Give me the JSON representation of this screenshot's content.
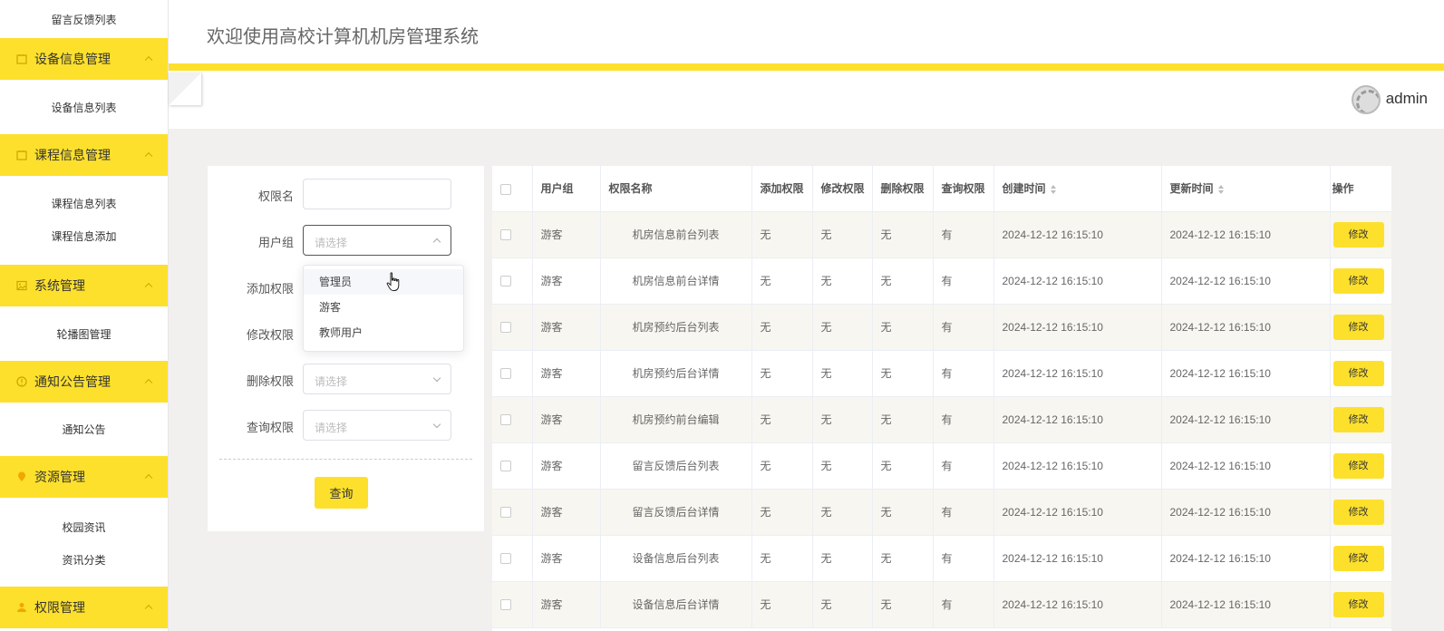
{
  "header": {
    "title": "欢迎使用高校计算机机房管理系统",
    "username": "admin"
  },
  "sidebar": {
    "top_sub": "留言反馈列表",
    "groups": [
      {
        "label": "设备信息管理",
        "icon": "calendar-icon",
        "items": [
          "设备信息列表"
        ]
      },
      {
        "label": "课程信息管理",
        "icon": "calendar-icon",
        "items": [
          "课程信息列表",
          "课程信息添加"
        ]
      },
      {
        "label": "系统管理",
        "icon": "image-icon",
        "items": [
          "轮播图管理"
        ]
      },
      {
        "label": "通知公告管理",
        "icon": "info-icon",
        "items": [
          "通知公告"
        ]
      },
      {
        "label": "资源管理",
        "icon": "location-icon",
        "items": [
          "校园资讯",
          "资讯分类"
        ]
      },
      {
        "label": "权限管理",
        "icon": "user-icon",
        "items": []
      }
    ]
  },
  "search": {
    "perm_name_label": "权限名",
    "user_group_label": "用户组",
    "user_group_placeholder": "请选择",
    "add_label": "添加权限",
    "modify_label": "修改权限",
    "delete_label": "删除权限",
    "delete_placeholder": "请选择",
    "query_label": "查询权限",
    "query_placeholder": "请选择",
    "dropdown_options": [
      "管理员",
      "游客",
      "教师用户"
    ],
    "query_button": "查询"
  },
  "table": {
    "columns": [
      "用户组",
      "权限名称",
      "添加权限",
      "修改权限",
      "删除权限",
      "查询权限",
      "创建时间",
      "更新时间",
      "操作"
    ],
    "edit_label": "修改",
    "rows": [
      [
        "游客",
        "机房信息前台列表",
        "无",
        "无",
        "无",
        "有",
        "2024-12-12 16:15:10",
        "2024-12-12 16:15:10"
      ],
      [
        "游客",
        "机房信息前台详情",
        "无",
        "无",
        "无",
        "有",
        "2024-12-12 16:15:10",
        "2024-12-12 16:15:10"
      ],
      [
        "游客",
        "机房预约后台列表",
        "无",
        "无",
        "无",
        "有",
        "2024-12-12 16:15:10",
        "2024-12-12 16:15:10"
      ],
      [
        "游客",
        "机房预约后台详情",
        "无",
        "无",
        "无",
        "有",
        "2024-12-12 16:15:10",
        "2024-12-12 16:15:10"
      ],
      [
        "游客",
        "机房预约前台编辑",
        "无",
        "无",
        "无",
        "有",
        "2024-12-12 16:15:10",
        "2024-12-12 16:15:10"
      ],
      [
        "游客",
        "留言反馈后台列表",
        "无",
        "无",
        "无",
        "有",
        "2024-12-12 16:15:10",
        "2024-12-12 16:15:10"
      ],
      [
        "游客",
        "留言反馈后台详情",
        "无",
        "无",
        "无",
        "有",
        "2024-12-12 16:15:10",
        "2024-12-12 16:15:10"
      ],
      [
        "游客",
        "设备信息后台列表",
        "无",
        "无",
        "无",
        "有",
        "2024-12-12 16:15:10",
        "2024-12-12 16:15:10"
      ],
      [
        "游客",
        "设备信息后台详情",
        "无",
        "无",
        "无",
        "有",
        "2024-12-12 16:15:10",
        "2024-12-12 16:15:10"
      ]
    ]
  },
  "colors": {
    "accent": "#fde02c",
    "background": "#f1f0ee"
  }
}
